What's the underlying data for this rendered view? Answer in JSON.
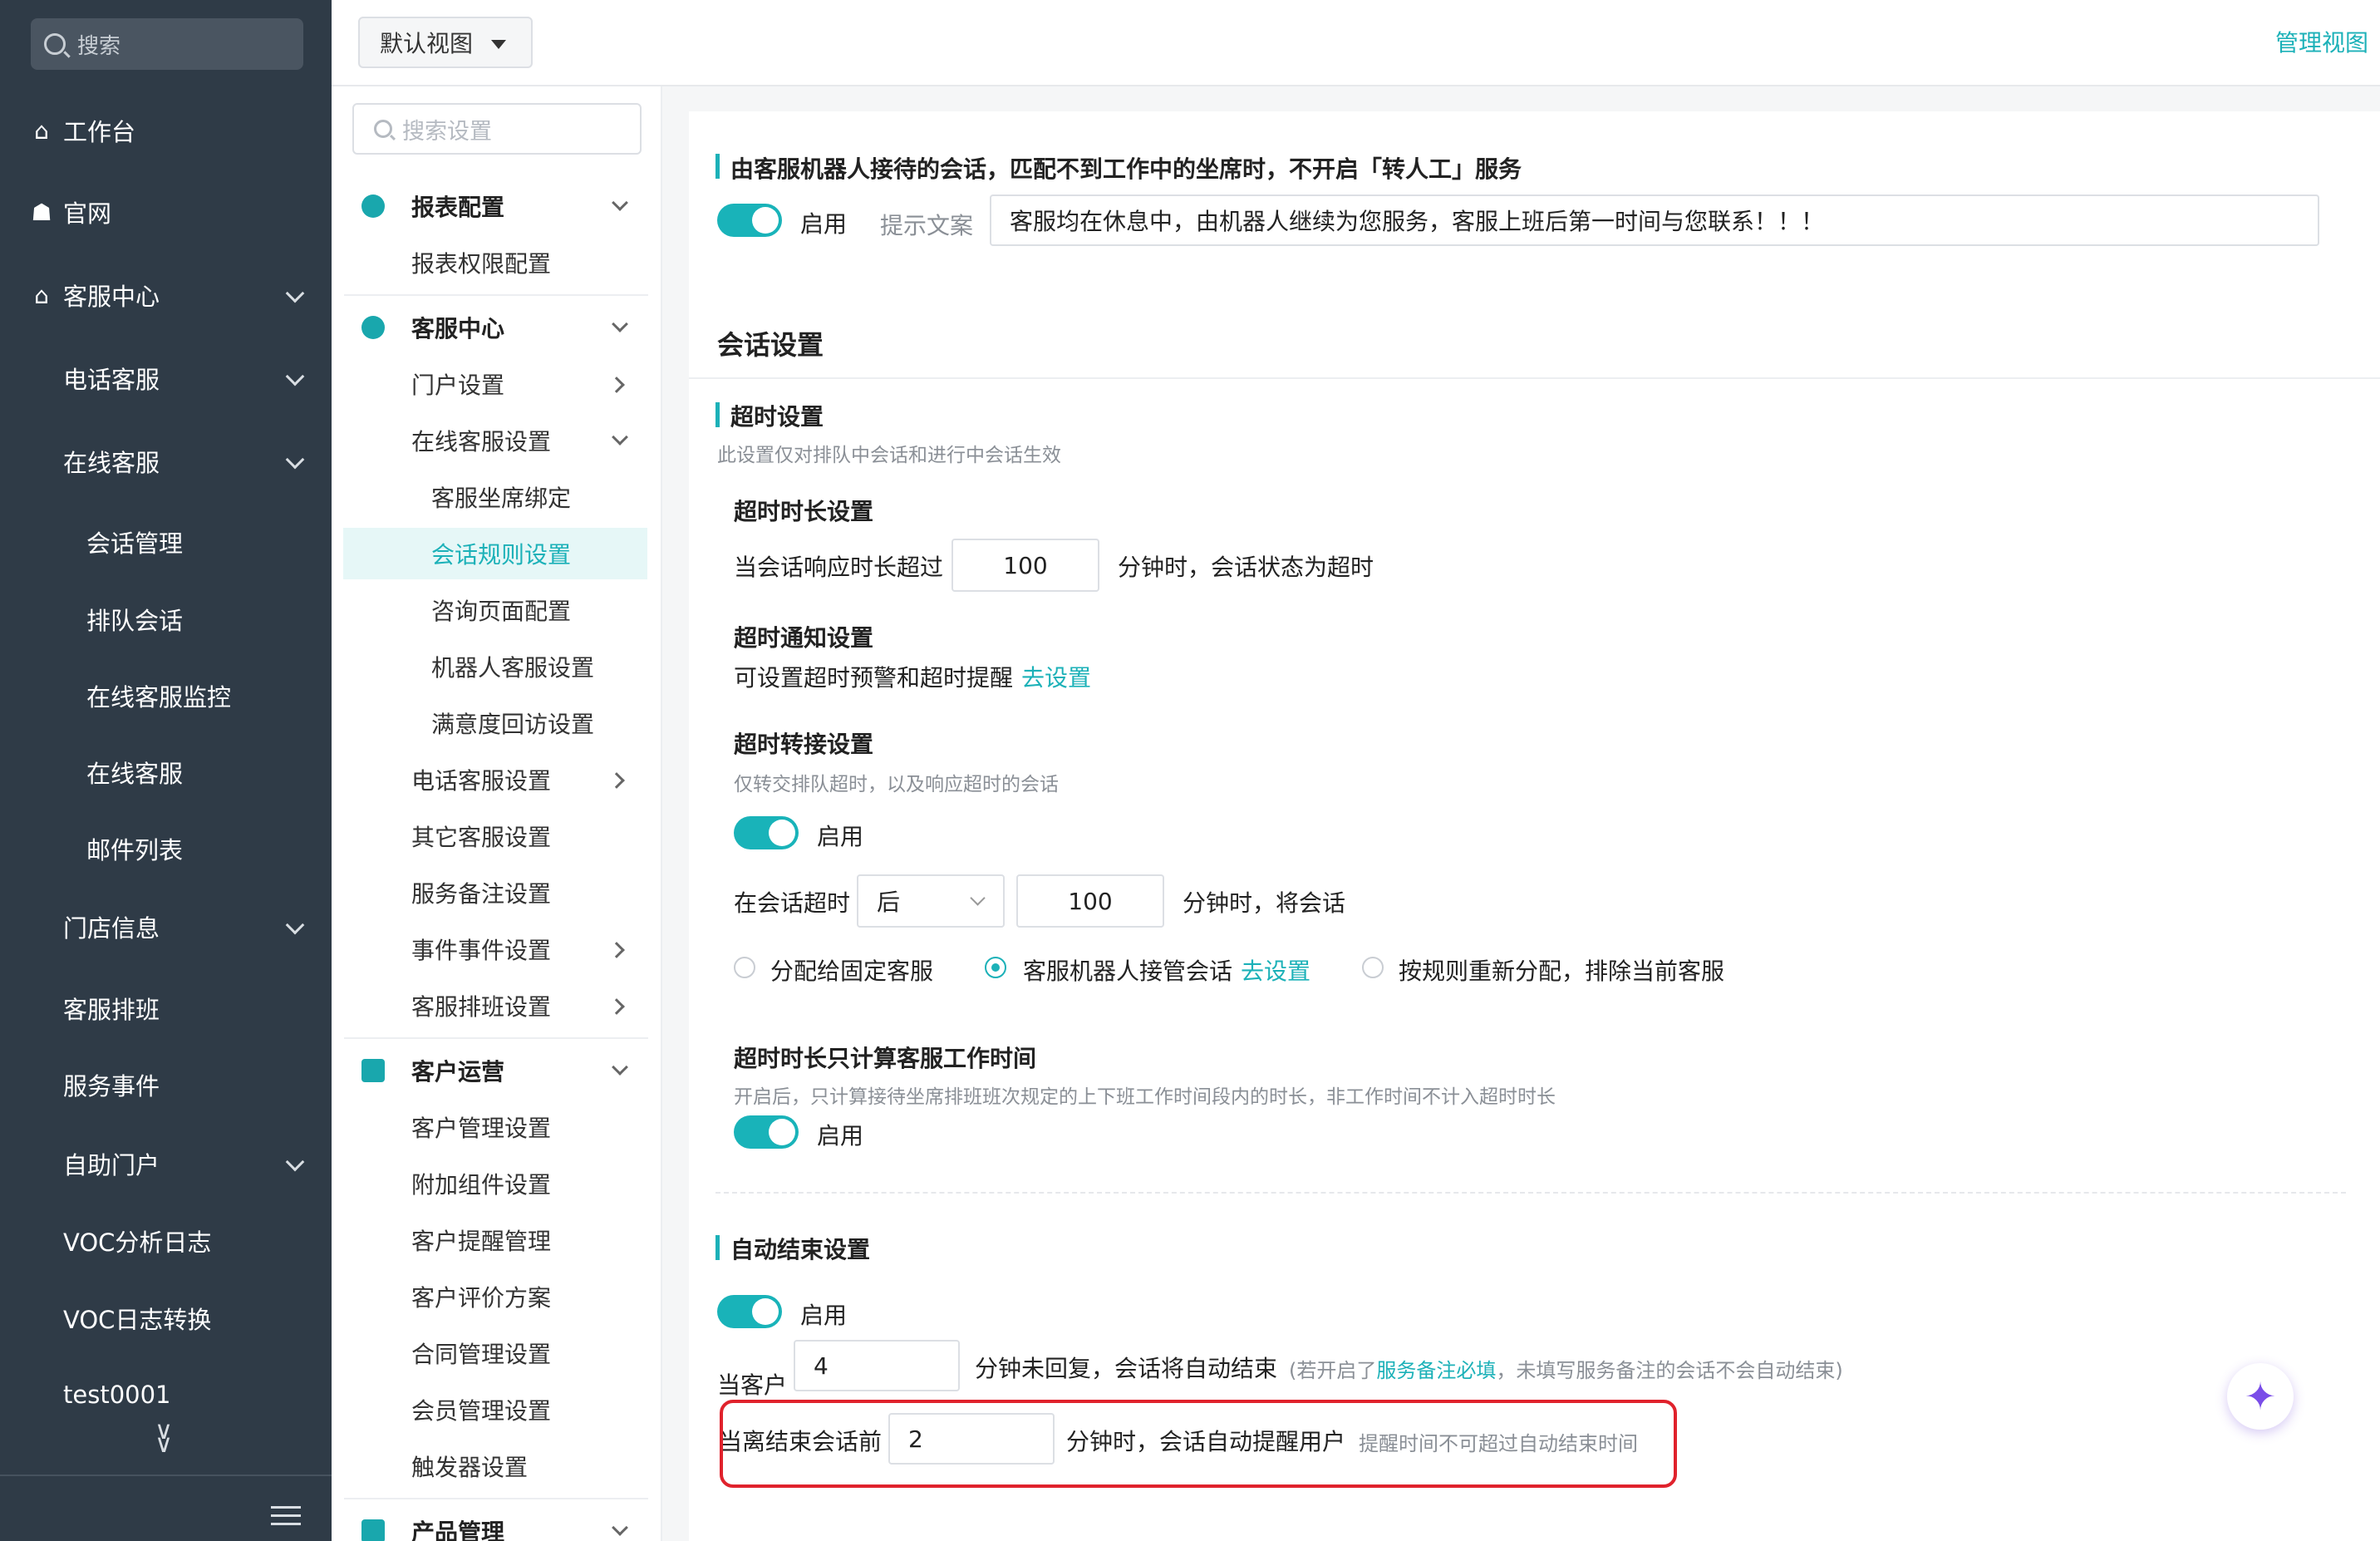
{
  "sidebar": {
    "search_placeholder": "搜索",
    "items": [
      {
        "label": "工作台",
        "icon": "home-icon"
      },
      {
        "label": "官网",
        "icon": "sitemap-icon"
      },
      {
        "label": "客服中心",
        "icon": "home-icon"
      },
      {
        "label": "电话客服"
      },
      {
        "label": "在线客服"
      },
      {
        "label": "会话管理"
      },
      {
        "label": "排队会话"
      },
      {
        "label": "在线客服监控"
      },
      {
        "label": "在线客服"
      },
      {
        "label": "邮件列表"
      },
      {
        "label": "门店信息"
      },
      {
        "label": "客服排班"
      },
      {
        "label": "服务事件"
      },
      {
        "label": "自助门户"
      },
      {
        "label": "VOC分析日志"
      },
      {
        "label": "VOC日志转换"
      },
      {
        "label": "test0001"
      }
    ]
  },
  "topbar": {
    "view_select": "默认视图",
    "manage_view": "管理视图"
  },
  "settings_nav": {
    "search_placeholder": "搜索设置",
    "items": [
      {
        "label": "报表配置"
      },
      {
        "label": "报表权限配置"
      },
      {
        "label": "客服中心"
      },
      {
        "label": "门户设置"
      },
      {
        "label": "在线客服设置"
      },
      {
        "label": "客服坐席绑定"
      },
      {
        "label": "会话规则设置"
      },
      {
        "label": "咨询页面配置"
      },
      {
        "label": "机器人客服设置"
      },
      {
        "label": "满意度回访设置"
      },
      {
        "label": "电话客服设置"
      },
      {
        "label": "其它客服设置"
      },
      {
        "label": "服务备注设置"
      },
      {
        "label": "事件事件设置"
      },
      {
        "label": "客服排班设置"
      },
      {
        "label": "客户运营"
      },
      {
        "label": "客户管理设置"
      },
      {
        "label": "附加组件设置"
      },
      {
        "label": "客户提醒管理"
      },
      {
        "label": "客户评价方案"
      },
      {
        "label": "合同管理设置"
      },
      {
        "label": "会员管理设置"
      },
      {
        "label": "触发器设置"
      },
      {
        "label": "产品管理"
      }
    ]
  },
  "robot": {
    "title": "由客服机器人接待的会话，匹配不到工作中的坐席时，不开启「转人工」服务",
    "enable": "启用",
    "hint_label": "提示文案",
    "hint_value": "客服均在休息中，由机器人继续为您服务，客服上班后第一时间与您联系！！！"
  },
  "session": {
    "title": "会话设置",
    "timeout": {
      "title": "超时设置",
      "desc": "此设置仅对排队中会话和进行中会话生效",
      "duration_title": "超时时长设置",
      "duration_prefix": "当会话响应时长超过",
      "duration_value": "100",
      "duration_suffix": "分钟时，会话状态为超时",
      "notify_title": "超时通知设置",
      "notify_desc": "可设置超时预警和超时提醒",
      "notify_link": "去设置",
      "transfer_title": "超时转接设置",
      "transfer_desc": "仅转交排队超时，以及响应超时的会话",
      "transfer_enable": "启用",
      "transfer_prefix": "在会话超时",
      "transfer_select": "后",
      "transfer_value": "100",
      "transfer_suffix": "分钟时，将会话",
      "radio1": "分配给固定客服",
      "radio2": "客服机器人接管会话",
      "radio2_link": "去设置",
      "radio3": "按规则重新分配，排除当前客服",
      "worktime_title": "超时时长只计算客服工作时间",
      "worktime_desc": "开启后，只计算接待坐席排班班次规定的上下班工作时间段内的时长，非工作时间不计入超时时长",
      "worktime_enable": "启用"
    },
    "auto_end": {
      "title": "自动结束设置",
      "enable": "启用",
      "end_prefix": "当客户",
      "end_value": "4",
      "end_suffix": "分钟未回复，会话将自动结束",
      "note_prefix": "(若开启了",
      "note_link": "服务备注必填",
      "note_suffix": "，未填写服务备注的会话不会自动结束)",
      "remind_prefix": "当离结束会话前",
      "remind_value": "2",
      "remind_suffix": "分钟时，会话自动提醒用户",
      "remind_note": "提醒时间不可超过自动结束时间"
    }
  },
  "colors": {
    "accent": "#1cb1b8",
    "sidebar": "#2f3b47",
    "highlight": "#e0222c"
  }
}
